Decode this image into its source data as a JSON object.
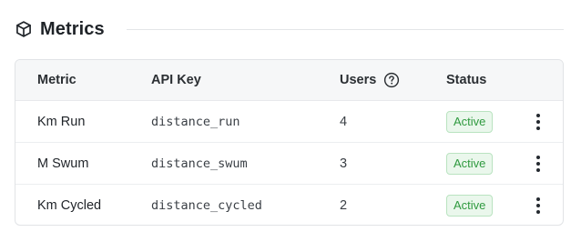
{
  "section": {
    "title": "Metrics",
    "icon": "cube-icon"
  },
  "table": {
    "columns": {
      "metric": "Metric",
      "api_key": "API Key",
      "users": "Users",
      "users_help_icon": "question-circle-icon",
      "status": "Status"
    },
    "rows": [
      {
        "metric": "Km Run",
        "api_key": "distance_run",
        "users": "4",
        "status": "Active"
      },
      {
        "metric": "M Swum",
        "api_key": "distance_swum",
        "users": "3",
        "status": "Active"
      },
      {
        "metric": "Km Cycled",
        "api_key": "distance_cycled",
        "users": "2",
        "status": "Active"
      }
    ],
    "row_menu_icon": "kebab-menu-icon"
  },
  "colors": {
    "status_active_text": "#2f9a3f",
    "status_active_bg": "#eaf7ec",
    "status_active_border": "#b9e3c0",
    "header_bg": "#f6f7f8"
  }
}
